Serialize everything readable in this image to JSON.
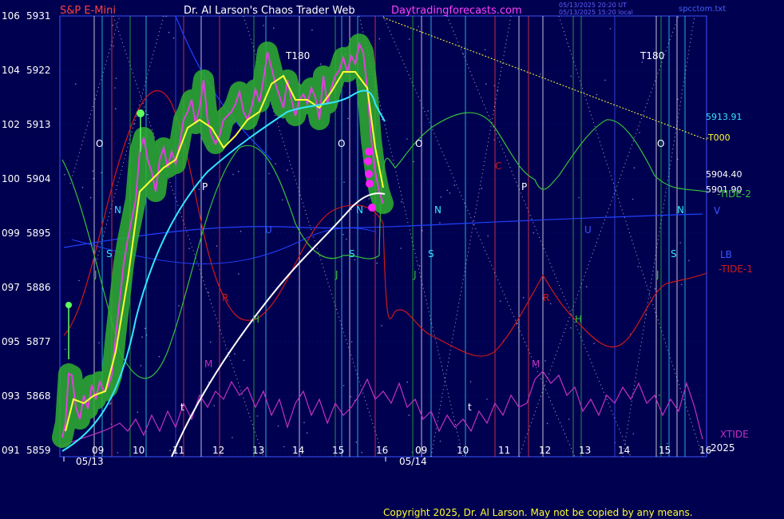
{
  "header": {
    "instrument": "S&P E-Mini",
    "title": "Dr. Al Larson's Chaos Trader Web",
    "site": "Daytradingforecasts.com",
    "stamp_ut": "05/13/2025 20:20 UT",
    "stamp_local": "05/13/2025 15:20 local",
    "file": "spcctom.txt"
  },
  "footer": {
    "copyright": "Copyright 2025, Dr. Al Larson. May not be copied by any means."
  },
  "colors": {
    "background": "#000050",
    "axis": "#3a55ff",
    "price_high": "#ffffff",
    "moving_avg_fast": "#ffff33",
    "moving_avg_slow": "#33e6ff",
    "ema_trend": "#ffffff",
    "tide1": "#d01818",
    "tide2": "#36c13a",
    "xtide": "#c030c0",
    "price_cloud": "#2fb02f",
    "price_line": "#e040e0"
  },
  "chart_data": {
    "type": "line",
    "left_axis": {
      "labels": [
        "091",
        "093",
        "095",
        "097",
        "099",
        "100",
        "102",
        "104",
        "106"
      ]
    },
    "price_axis": {
      "ticks": [
        5859,
        5868,
        5877,
        5886,
        5895,
        5904,
        5913,
        5922,
        5931
      ]
    },
    "x_hour_labels": [
      "09",
      "10",
      "11",
      "12",
      "13",
      "14",
      "15",
      "16",
      "09",
      "10",
      "11",
      "12",
      "13",
      "14",
      "15",
      "16"
    ],
    "date_labels": [
      "05/13",
      "05/14"
    ],
    "price_labels": [
      "5913.91",
      "5904.40",
      "5901.90"
    ],
    "right_labels": {
      "t000": "-T000",
      "tide2": "-TIDE-2",
      "v": "V",
      "lb": "LB",
      "tide1": "-TIDE-1",
      "xtide": "XTIDE",
      "year": "2025"
    },
    "annotations": [
      {
        "text": "T180",
        "color": "#ffffff"
      },
      {
        "text": "T180",
        "color": "#ffffff"
      },
      {
        "text": "O",
        "color": "#ffffff"
      },
      {
        "text": "O",
        "color": "#ffffff"
      },
      {
        "text": "O",
        "color": "#ffffff"
      },
      {
        "text": "O",
        "color": "#ffffff"
      },
      {
        "text": "N",
        "color": "#33e6ff"
      },
      {
        "text": "N",
        "color": "#33e6ff"
      },
      {
        "text": "N",
        "color": "#33e6ff"
      },
      {
        "text": "N",
        "color": "#33e6ff"
      },
      {
        "text": "S",
        "color": "#33e6ff"
      },
      {
        "text": "S",
        "color": "#33e6ff"
      },
      {
        "text": "S",
        "color": "#33e6ff"
      },
      {
        "text": "S",
        "color": "#33e6ff"
      },
      {
        "text": "J",
        "color": "#36c13a"
      },
      {
        "text": "J",
        "color": "#36c13a"
      },
      {
        "text": "J",
        "color": "#36c13a"
      },
      {
        "text": "J",
        "color": "#36c13a"
      },
      {
        "text": "P",
        "color": "#ffffff"
      },
      {
        "text": "P",
        "color": "#ffffff"
      },
      {
        "text": "R",
        "color": "#d01818"
      },
      {
        "text": "R",
        "color": "#d01818"
      },
      {
        "text": "H",
        "color": "#36c13a"
      },
      {
        "text": "H",
        "color": "#36c13a"
      },
      {
        "text": "M",
        "color": "#c030c0"
      },
      {
        "text": "M",
        "color": "#c030c0"
      },
      {
        "text": "C",
        "color": "#d01818"
      },
      {
        "text": "U",
        "color": "#3a55ff"
      },
      {
        "text": "U",
        "color": "#3a55ff"
      },
      {
        "text": "t",
        "color": "#ffffff"
      },
      {
        "text": "t",
        "color": "#ffffff"
      }
    ],
    "series": [
      {
        "name": "S&P E-Mini",
        "x_hours": [
          8.3,
          8.6,
          9.0,
          9.4,
          9.8,
          10.0,
          10.3,
          10.6,
          11.0,
          11.4,
          11.8,
          12.1,
          12.5,
          12.9,
          13.3,
          13.7,
          14.1,
          14.5,
          14.9,
          15.3,
          15.6,
          15.9
        ],
        "values": [
          5860,
          5869,
          5866,
          5869,
          5868,
          5882,
          5903,
          5906,
          5905,
          5911,
          5917,
          5910,
          5914,
          5918,
          5912,
          5915,
          5924,
          5913,
          5912,
          5921,
          5925,
          5920
        ]
      },
      {
        "name": "TIDE-1",
        "x_hours": [
          8.3,
          9.0,
          9.8,
          10.3,
          10.8,
          11.3,
          11.8,
          12.3,
          12.8,
          13.3,
          13.8,
          14.3,
          14.8,
          15.3,
          15.8
        ],
        "values": [
          5888,
          5904,
          5916,
          5924,
          5918,
          5900,
          5880,
          5878,
          5883,
          5889,
          5893,
          5896,
          5898,
          5899,
          5897
        ]
      },
      {
        "name": "XTIDE",
        "x_hours": [
          8.3,
          9.0,
          9.6,
          10.2,
          10.8,
          11.4,
          12.0,
          12.6,
          13.2,
          13.8,
          14.4,
          15.0,
          15.6
        ],
        "values": [
          5863,
          5866,
          5862,
          5864,
          5862,
          5865,
          5868,
          5863,
          5866,
          5864,
          5867,
          5864,
          5866
        ]
      },
      {
        "name": "TIDE-2",
        "x_hours": [
          8.3,
          9.0,
          9.8,
          10.5,
          11.2,
          11.8,
          12.4,
          13.0,
          13.6,
          14.2,
          14.8,
          15.4,
          15.9
        ],
        "values": [
          5906,
          5895,
          5872,
          5868,
          5878,
          5892,
          5907,
          5909,
          5902,
          5892,
          5889,
          5890,
          5891
        ]
      }
    ]
  }
}
